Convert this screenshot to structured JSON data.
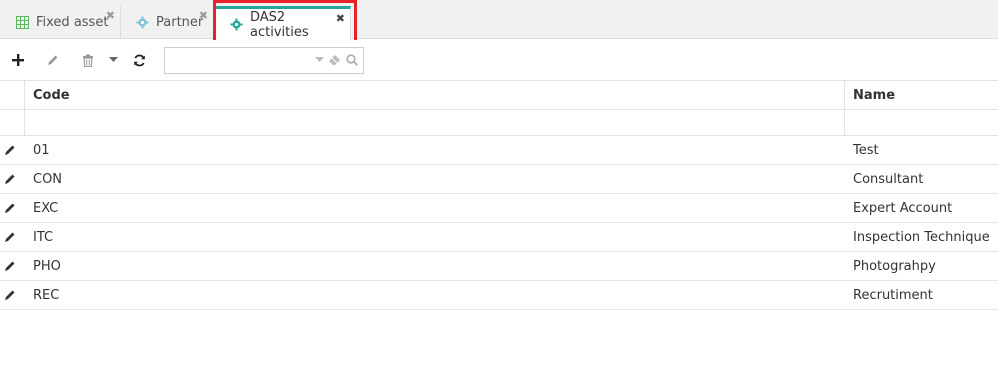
{
  "tabs": [
    {
      "label": "Fixed asset",
      "icon": "table-icon",
      "active": false
    },
    {
      "label": "Partner",
      "icon": "gear-icon",
      "active": false
    },
    {
      "label": "DAS2 activities",
      "icon": "gear-icon",
      "active": true
    }
  ],
  "toolbar": {
    "add_icon": "plus-icon",
    "edit_icon": "pencil-icon",
    "delete_icon": "trash-icon",
    "dropdown_icon": "caret-down-icon",
    "refresh_icon": "refresh-icon",
    "search": {
      "value": "",
      "placeholder": ""
    }
  },
  "grid": {
    "columns": [
      "Code",
      "Name"
    ],
    "rows": [
      {
        "code": "01",
        "name": "Test"
      },
      {
        "code": "CON",
        "name": "Consultant"
      },
      {
        "code": "EXC",
        "name": "Expert Account"
      },
      {
        "code": "ITC",
        "name": "Inspection Technique"
      },
      {
        "code": "PHO",
        "name": "Photograhpy"
      },
      {
        "code": "REC",
        "name": "Recrutiment"
      }
    ]
  },
  "colors": {
    "accent": "#26a69a",
    "highlight": "#e8202a"
  }
}
